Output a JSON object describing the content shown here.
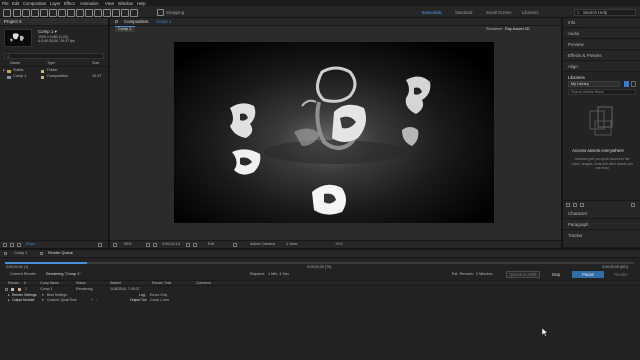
{
  "menu": [
    "File",
    "Edit",
    "Composition",
    "Layer",
    "Effect",
    "Animation",
    "View",
    "Window",
    "Help"
  ],
  "toolbar": {
    "snapping": "Snapping",
    "workspaces": [
      "Essentials",
      "Standard",
      "Small Screen",
      "Libraries"
    ],
    "search_placeholder": "Search Help"
  },
  "project": {
    "title": "Project ≡",
    "comp_name": "Comp 1 ▾",
    "comp_info": [
      "1920 x 1080 (1.00)",
      "Δ 0;00;20;00, 29.97 fps"
    ],
    "search_placeholder": "⌕",
    "columns": [
      "Name",
      "Type",
      "Size"
    ],
    "items": [
      {
        "name": "Solids",
        "type": "Folder",
        "size": "",
        "color": "#d9c14a"
      },
      {
        "name": "Comp 1",
        "type": "Composition",
        "size": "29.97",
        "color": "#c9b27a"
      }
    ],
    "bpc": "8 bpc"
  },
  "composition": {
    "title": "Composition",
    "name": "Comp 1",
    "tab": "Comp 1",
    "renderer_label": "Renderer:",
    "renderer_value": "Ray-traced 3D",
    "footer": {
      "zoom": "50%",
      "timecode": "0;00;02;14",
      "resolution": "Full",
      "camera": "Active Camera",
      "views": "1 View",
      "plus": "+0.0"
    }
  },
  "right_panels": [
    "Info",
    "Audio",
    "Preview",
    "Effects & Presets",
    "Align"
  ],
  "libraries": {
    "title": "Libraries",
    "library_name": "My Library",
    "search_placeholder": "Search Adobe Stock",
    "access_title": "Access assets everywhere",
    "access_body": "Libraries give you quick access to the colors, images, fonts and other assets you use most"
  },
  "right_panels_bottom": [
    "Character",
    "Paragraph",
    "Tracker"
  ],
  "timeline": {
    "tab_comp": "Comp 1",
    "tab_render": "Render Queue",
    "bar_left": "0;00;00;00 (1)",
    "bar_mid": "0;00;02;20 (79)",
    "bar_right": "0;00;20;00 (601)",
    "progress": 0.13,
    "current_render_label": "Current Render",
    "rendering_label": "Rendering \"Comp 1\"",
    "elapsed_label": "Elapsed:",
    "elapsed_value": "1 Min, 4 Sec",
    "remain_label": "Est. Remain:",
    "remain_value": "2 Minutes",
    "queue_ame": "Queue in AME",
    "stop": "Stop",
    "pause": "Pause",
    "render": "Render",
    "columns": [
      "Render",
      "#",
      "Comp Name",
      "Status",
      "Started",
      "Render Time",
      "Comment"
    ],
    "row": {
      "num": "1",
      "comp": "Comp 1",
      "status": "Rendering",
      "started": "11/8/2016, 7:35:37"
    },
    "settings_label": "Render Settings:",
    "settings_value": "Best Settings",
    "log_label": "Log:",
    "log_value": "Errors Only",
    "output_label": "Output Module:",
    "output_value": "Custom: QuickTime",
    "output_to_label": "Output To:",
    "output_to_value": "Comp 1.mov"
  }
}
